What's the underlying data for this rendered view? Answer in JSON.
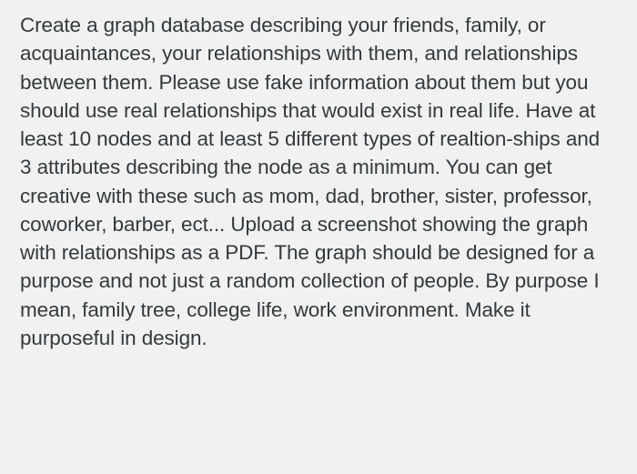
{
  "question": {
    "text": "Create a graph database describing your friends, family, or acquaintances, your relationships with them, and relationships between them.  Please use fake information about them but you should use real relationships that would exist in real life.  Have at least 10 nodes and at least 5 different types of realtion-ships and 3 attributes describing the node as a minimum.  You can get creative with these such as mom, dad, brother, sister, professor, coworker, barber, ect...  Upload a screenshot showing the graph with relationships as a PDF.  The graph should be designed for a purpose and not just a random collection of people.  By purpose I mean, family tree, college life, work environment.  Make it purposeful in design."
  }
}
